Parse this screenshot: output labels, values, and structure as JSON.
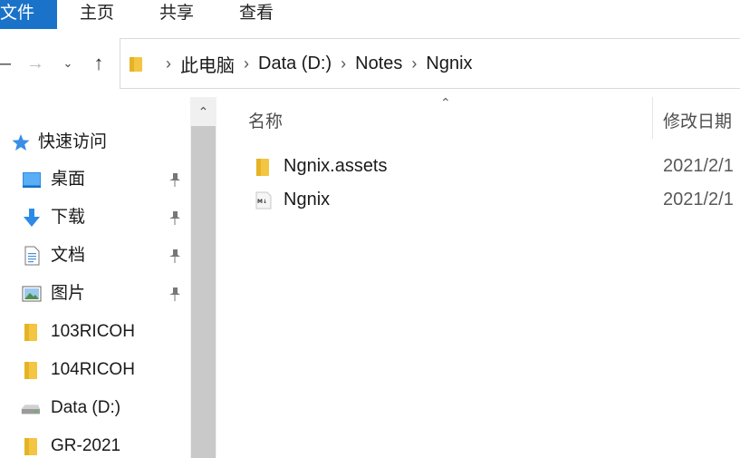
{
  "ribbon": {
    "tabs": [
      "文件",
      "主页",
      "共享",
      "查看"
    ]
  },
  "address": {
    "crumbs": [
      "此电脑",
      "Data (D:)",
      "Notes",
      "Ngnix"
    ],
    "back_icon": "back-arrow-icon",
    "forward_icon": "forward-arrow-icon",
    "recent_icon": "chevron-down-icon",
    "up_icon": "up-arrow-icon"
  },
  "navpane": {
    "quick_access": "快速访问",
    "items": [
      {
        "label": "桌面",
        "icon": "desktop-icon",
        "pinned": true
      },
      {
        "label": "下载",
        "icon": "download-icon",
        "pinned": true
      },
      {
        "label": "文档",
        "icon": "document-icon",
        "pinned": true
      },
      {
        "label": "图片",
        "icon": "pictures-icon",
        "pinned": true
      },
      {
        "label": "103RICOH",
        "icon": "folder-icon",
        "pinned": false
      },
      {
        "label": "104RICOH",
        "icon": "folder-icon",
        "pinned": false
      },
      {
        "label": "Data (D:)",
        "icon": "drive-icon",
        "pinned": false
      },
      {
        "label": "GR-2021",
        "icon": "folder-icon",
        "pinned": false
      }
    ]
  },
  "content": {
    "columns": {
      "name": "名称",
      "date": "修改日期"
    },
    "files": [
      {
        "name": "Ngnix.assets",
        "date": "2021/2/1",
        "icon": "folder-icon"
      },
      {
        "name": "Ngnix",
        "date": "2021/2/1",
        "icon": "markdown-file-icon"
      }
    ]
  },
  "colors": {
    "accent": "#1a73c9",
    "folder": "#f4c542"
  }
}
